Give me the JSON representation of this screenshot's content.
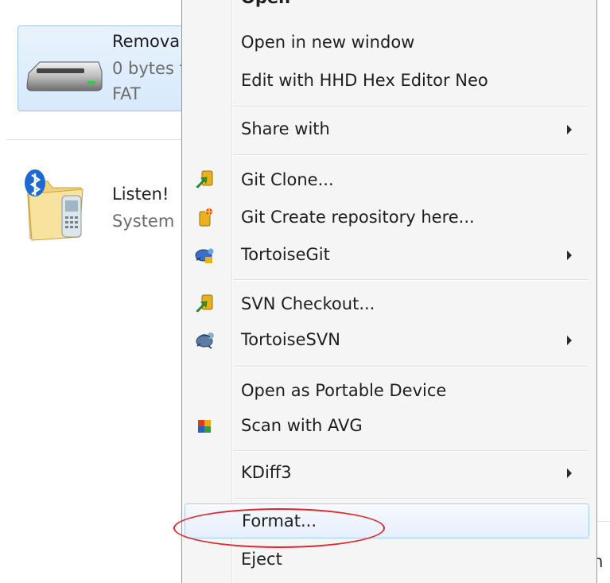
{
  "explorer": {
    "drive": {
      "name": "Remova",
      "size": "0 bytes f",
      "fs": "FAT"
    },
    "device": {
      "name": "Listen!",
      "type": "System"
    },
    "cutoff_text": "m"
  },
  "menu": {
    "open_partial": "Open",
    "items": [
      {
        "label": "Open in new window"
      },
      {
        "label": "Edit with HHD Hex Editor Neo"
      },
      {
        "label": "Share with"
      },
      {
        "label": "Git Clone..."
      },
      {
        "label": "Git Create repository here..."
      },
      {
        "label": "TortoiseGit"
      },
      {
        "label": "SVN Checkout..."
      },
      {
        "label": "TortoiseSVN"
      },
      {
        "label": "Open as Portable Device"
      },
      {
        "label": "Scan with AVG"
      },
      {
        "label": "KDiff3"
      },
      {
        "label": "Format..."
      },
      {
        "label": "Eject"
      }
    ]
  },
  "colors": {
    "highlight_border": "#aeccf1",
    "annotation_circle": "#e0262c",
    "selection_tile": "#d6e9fb"
  }
}
